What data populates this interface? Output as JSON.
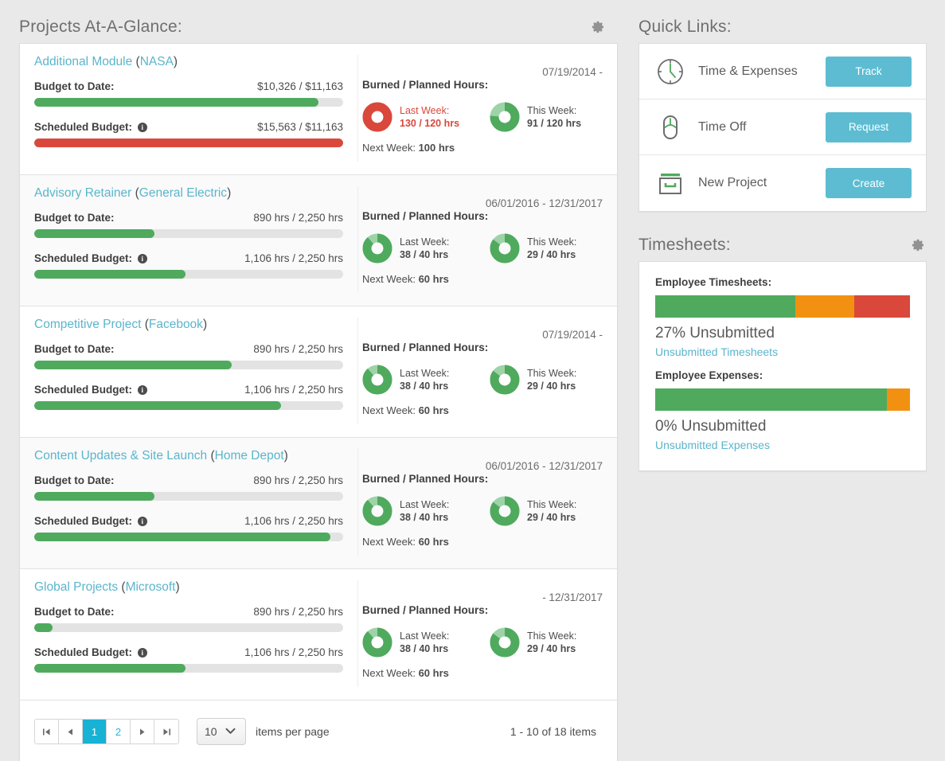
{
  "projects_panel": {
    "title": "Projects At-A-Glance:",
    "gear_icon": "gear-icon",
    "labels": {
      "budget_to_date": "Budget to Date:",
      "scheduled_budget": "Scheduled Budget:",
      "burned_planned": "Burned / Planned Hours:",
      "last_week": "Last Week:",
      "this_week": "This Week:",
      "next_week_prefix": "Next Week:",
      "info_icon": "info-icon"
    },
    "projects": [
      {
        "name": "Additional Module",
        "client": "NASA",
        "date_range": "07/19/2014 -",
        "budget_to_date_value": "$10,326 / $11,163",
        "budget_to_date_pct": 92,
        "budget_to_date_color": "green",
        "scheduled_budget_value": "$15,563 / $11,163",
        "scheduled_budget_pct": 100,
        "scheduled_budget_color": "red",
        "last_week_value": "130 / 120 hrs",
        "last_week_pct": 100,
        "last_week_over": true,
        "this_week_value": "91 / 120 hrs",
        "this_week_pct": 76,
        "next_week_value": "100 hrs"
      },
      {
        "name": "Advisory Retainer",
        "client": "General Electric",
        "date_range": "06/01/2016 - 12/31/2017",
        "budget_to_date_value": "890 hrs / 2,250 hrs",
        "budget_to_date_pct": 39,
        "budget_to_date_color": "green",
        "scheduled_budget_value": "1,106 hrs / 2,250 hrs",
        "scheduled_budget_pct": 49,
        "scheduled_budget_color": "green",
        "last_week_value": "38 / 40 hrs",
        "last_week_pct": 88,
        "last_week_over": false,
        "this_week_value": "29 / 40 hrs",
        "this_week_pct": 85,
        "next_week_value": "60 hrs"
      },
      {
        "name": "Competitive Project",
        "client": "Facebook",
        "date_range": "07/19/2014 -",
        "budget_to_date_value": "890 hrs / 2,250 hrs",
        "budget_to_date_pct": 64,
        "budget_to_date_color": "green",
        "scheduled_budget_value": "1,106 hrs / 2,250 hrs",
        "scheduled_budget_pct": 80,
        "scheduled_budget_color": "green",
        "last_week_value": "38 / 40 hrs",
        "last_week_pct": 88,
        "last_week_over": false,
        "this_week_value": "29 / 40 hrs",
        "this_week_pct": 85,
        "next_week_value": "60 hrs"
      },
      {
        "name": "Content Updates & Site Launch",
        "client": "Home Depot",
        "date_range": "06/01/2016 - 12/31/2017",
        "budget_to_date_value": "890 hrs / 2,250 hrs",
        "budget_to_date_pct": 39,
        "budget_to_date_color": "green",
        "scheduled_budget_value": "1,106 hrs / 2,250 hrs",
        "scheduled_budget_pct": 96,
        "scheduled_budget_color": "green",
        "last_week_value": "38 / 40 hrs",
        "last_week_pct": 88,
        "last_week_over": false,
        "this_week_value": "29 / 40 hrs",
        "this_week_pct": 85,
        "next_week_value": "60 hrs"
      },
      {
        "name": "Global Projects",
        "client": "Microsoft",
        "date_range": "- 12/31/2017",
        "budget_to_date_value": "890 hrs / 2,250 hrs",
        "budget_to_date_pct": 6,
        "budget_to_date_color": "green",
        "scheduled_budget_value": "1,106 hrs / 2,250 hrs",
        "scheduled_budget_pct": 49,
        "scheduled_budget_color": "green",
        "last_week_value": "38 / 40 hrs",
        "last_week_pct": 88,
        "last_week_over": false,
        "this_week_value": "29 / 40 hrs",
        "this_week_pct": 85,
        "next_week_value": "60 hrs"
      }
    ],
    "pager": {
      "first_label": "first-page",
      "prev_label": "previous-page",
      "pages": [
        "1",
        "2"
      ],
      "active_page": "1",
      "next_label": "next-page",
      "last_label": "last-page",
      "items_per_page_value": "10",
      "items_per_page_label": "items per page",
      "range_text": "1 - 10 of 18 items"
    }
  },
  "quick_links": {
    "title": "Quick Links:",
    "items": [
      {
        "icon": "clock-icon",
        "label": "Time & Expenses",
        "button": "Track"
      },
      {
        "icon": "sandal-icon",
        "label": "Time Off",
        "button": "Request"
      },
      {
        "icon": "briefcase-icon",
        "label": "New Project",
        "button": "Create"
      }
    ]
  },
  "timesheets": {
    "title": "Timesheets:",
    "gear_icon": "gear-icon",
    "employee_timesheets": {
      "label": "Employee Timesheets:",
      "segments": [
        {
          "color": "#4faa5e",
          "pct": 55
        },
        {
          "color": "#f29111",
          "pct": 23
        },
        {
          "color": "#d9483b",
          "pct": 22
        }
      ],
      "percent_text": "27% Unsubmitted",
      "link": "Unsubmitted Timesheets"
    },
    "employee_expenses": {
      "label": "Employee Expenses:",
      "segments": [
        {
          "color": "#4faa5e",
          "pct": 91
        },
        {
          "color": "#f29111",
          "pct": 9
        }
      ],
      "percent_text": "0% Unsubmitted",
      "link": "Unsubmitted Expenses"
    }
  },
  "colors": {
    "accent_blue": "#5ab5cc",
    "pager_active": "#18b2d4",
    "green": "#4faa5e",
    "orange": "#f29111",
    "red": "#d9483b",
    "page_bg": "#e9e9e9"
  }
}
